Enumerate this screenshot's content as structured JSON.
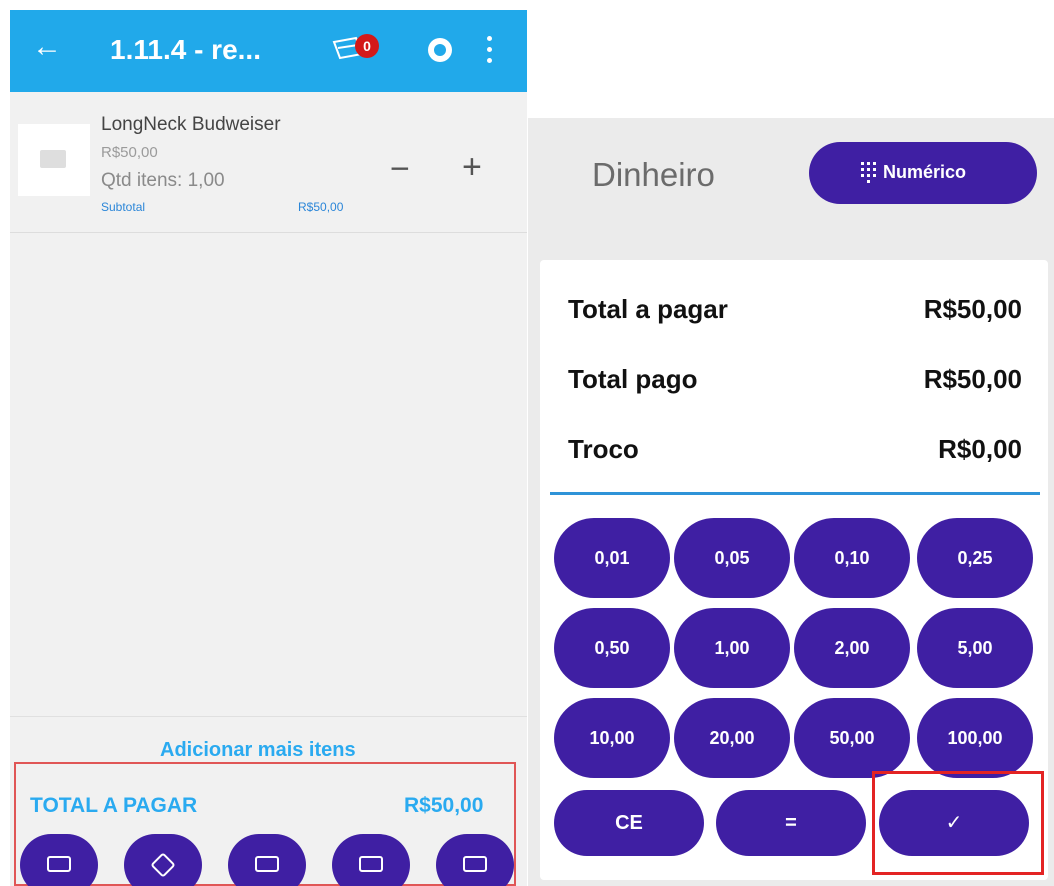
{
  "left": {
    "appbar": {
      "back_icon": "arrow-left-icon",
      "title": "1.11.4 - re...",
      "cart_icon": "cart-icon",
      "cart_badge": "0",
      "sync_icon": "sync-icon",
      "more_icon": "more-vert-icon"
    },
    "item": {
      "name": "LongNeck Budweiser",
      "price": "R$50,00",
      "qty": "Qtd itens: 1,00",
      "subtotal_label": "Subtotal",
      "subtotal_value": "R$50,00",
      "minus": "−",
      "plus": "+"
    },
    "add_more": "Adicionar mais itens",
    "total": {
      "label": "TOTAL A PAGAR",
      "value": "R$50,00"
    },
    "payment_buttons": [
      "split-icon",
      "pix-icon",
      "voucher-icon",
      "cash-icon",
      "card-icon"
    ]
  },
  "right": {
    "method": "Dinheiro",
    "numeric_button": "Numérico",
    "summary": [
      {
        "label": "Total a pagar",
        "value": "R$50,00"
      },
      {
        "label": "Total pago",
        "value": "R$50,00"
      },
      {
        "label": "Troco",
        "value": "R$0,00"
      }
    ],
    "keys": [
      "0,01",
      "0,05",
      "0,10",
      "0,25",
      "0,50",
      "1,00",
      "2,00",
      "5,00",
      "10,00",
      "20,00",
      "50,00",
      "100,00"
    ],
    "ce": "CE",
    "equals": "=",
    "confirm": "✓"
  },
  "colors": {
    "appbar": "#21a9ea",
    "accent": "#3f1fa3",
    "badge": "#d31919",
    "total_text": "#2aaaf0",
    "highlight": "#e32323"
  }
}
